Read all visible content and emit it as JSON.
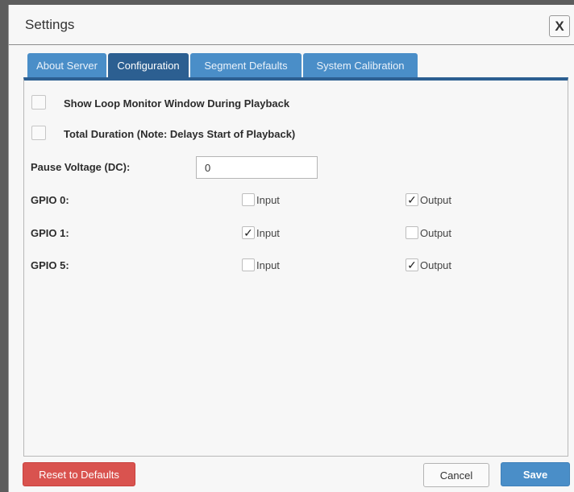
{
  "dialog": {
    "title": "Settings",
    "close_label": "X"
  },
  "tabs": [
    {
      "label": "About Server",
      "active": false
    },
    {
      "label": "Configuration",
      "active": true
    },
    {
      "label": "Segment Defaults",
      "active": false
    },
    {
      "label": "System Calibration",
      "active": false
    }
  ],
  "options": {
    "loop_monitor_label": "Show Loop Monitor Window During Playback",
    "loop_monitor_checked": false,
    "total_duration_label": "Total Duration (Note: Delays Start of Playback)",
    "total_duration_checked": false
  },
  "pause_voltage": {
    "label": "Pause Voltage (DC):",
    "value": "0"
  },
  "gpio": [
    {
      "label": "GPIO 0:",
      "input_label": "Input",
      "output_label": "Output",
      "input_checked": false,
      "output_checked": true
    },
    {
      "label": "GPIO 1:",
      "input_label": "Input",
      "output_label": "Output",
      "input_checked": true,
      "output_checked": false
    },
    {
      "label": "GPIO 5:",
      "input_label": "Input",
      "output_label": "Output",
      "input_checked": false,
      "output_checked": true
    }
  ],
  "footer": {
    "reset_label": "Reset to Defaults",
    "cancel_label": "Cancel",
    "save_label": "Save"
  },
  "check_glyph": "✓",
  "colors": {
    "tab_blue": "#4a8ec8",
    "tab_active": "#2c5f91",
    "reset_red": "#d9534f",
    "save_blue": "#4a8ec8"
  }
}
